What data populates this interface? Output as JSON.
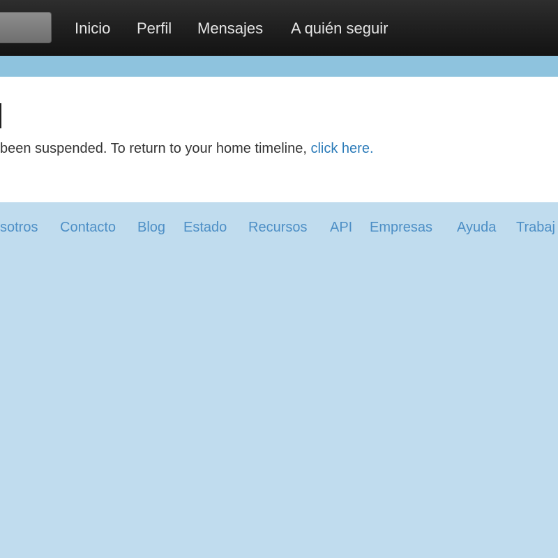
{
  "header": {
    "nav_items": [
      "Inicio",
      "Perfil",
      "Mensajes",
      "A quién seguir"
    ]
  },
  "content": {
    "message_text": "been suspended. To return to your home timeline, ",
    "link_text": "click here."
  },
  "footer": {
    "links": [
      "sotros",
      "Contacto",
      "Blog",
      "Estado",
      "Recursos",
      "API",
      "Empresas",
      "Ayuda",
      "Trabaj"
    ]
  },
  "colors": {
    "topbar": "#1a1a1a",
    "strip": "#8ec3de",
    "background": "#c0dcee",
    "link": "#2a7ab8",
    "footer_link": "#4d8fc6"
  }
}
